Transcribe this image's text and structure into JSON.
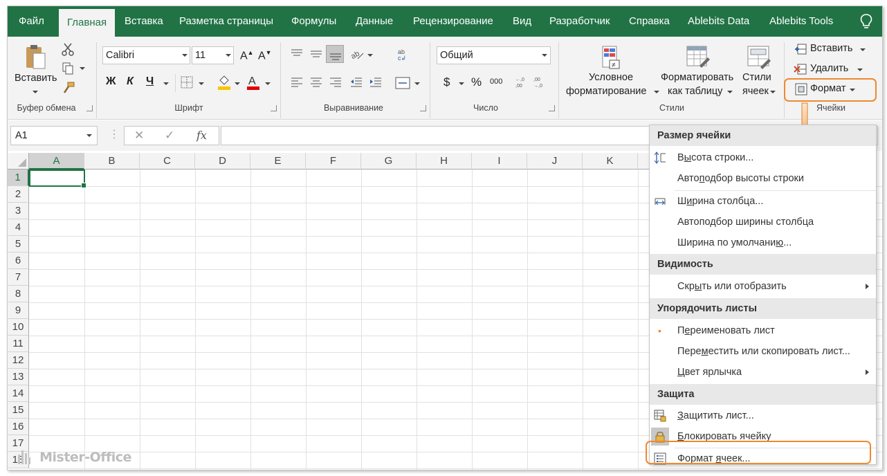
{
  "tabs": [
    "Файл",
    "Главная",
    "Вставка",
    "Разметка страницы",
    "Формулы",
    "Данные",
    "Рецензирование",
    "Вид",
    "Разработчик",
    "Справка",
    "Ablebits Data",
    "Ablebits Tools"
  ],
  "active_tab": "Главная",
  "clipboard": {
    "paste_label": "Вставить",
    "group_label": "Буфер обмена"
  },
  "font": {
    "name": "Calibri",
    "size": "11",
    "bold": "Ж",
    "italic": "К",
    "underline": "Ч",
    "group_label": "Шрифт"
  },
  "alignment": {
    "group_label": "Выравнивание"
  },
  "number": {
    "format": "Общий",
    "currency": "$",
    "percent": "%",
    "thousands": "000",
    "group_label": "Число"
  },
  "styles": {
    "conditional_line1": "Условное",
    "conditional_line2": "форматирование",
    "table_line1": "Форматировать",
    "table_line2": "как таблицу",
    "cell_line1": "Стили",
    "cell_line2": "ячеек",
    "group_label": "Стили"
  },
  "cells": {
    "insert": "Вставить",
    "delete": "Удалить",
    "format": "Формат",
    "group_label": "Ячейки"
  },
  "formula_bar": {
    "name_box": "A1",
    "fx": "fx",
    "cancel": "✕",
    "enter": "✓"
  },
  "columns": [
    "A",
    "B",
    "C",
    "D",
    "E",
    "F",
    "G",
    "H",
    "I",
    "J",
    "K"
  ],
  "rows": [
    "1",
    "2",
    "3",
    "4",
    "5",
    "6",
    "7",
    "8",
    "9",
    "10",
    "11",
    "12",
    "13",
    "14",
    "15",
    "16",
    "17",
    "18"
  ],
  "menu": {
    "section_size": "Размер ячейки",
    "row_height_a": "В",
    "row_height_u": "ы",
    "row_height_b": "сота строки...",
    "autofit_row_a": "Авто",
    "autofit_row_u": "п",
    "autofit_row_b": "одбор высоты строки",
    "col_width_a": "Ш",
    "col_width_u": "и",
    "col_width_b": "рина столбца...",
    "autofit_col_a": "Автопо",
    "autofit_col_u": "д",
    "autofit_col_b": "бор ширины столбца",
    "default_width_a": "Ширина по умолчани",
    "default_width_u": "ю",
    "default_width_b": "...",
    "section_visibility": "Видимость",
    "hide_show_a": "Скр",
    "hide_show_u": "ы",
    "hide_show_b": "ть или отобразить",
    "section_sheets": "Упорядочить листы",
    "rename_a": "П",
    "rename_u": "е",
    "rename_b": "реименовать лист",
    "move_copy_a": "Пере",
    "move_copy_u": "м",
    "move_copy_b": "естить или скопировать лист...",
    "tab_color_a": "",
    "tab_color_u": "Ц",
    "tab_color_b": "вет ярлычка",
    "section_protect": "Защита",
    "protect_a": "",
    "protect_u": "З",
    "protect_b": "ащитить лист...",
    "lock_a": "",
    "lock_u": "Б",
    "lock_b": "локировать ячейку",
    "format_cells_a": "Формат ",
    "format_cells_u": "я",
    "format_cells_b": "чеек..."
  },
  "watermark": "Mister-Office",
  "colors": {
    "excel_green": "#217346",
    "highlight_orange": "#f0892d"
  }
}
